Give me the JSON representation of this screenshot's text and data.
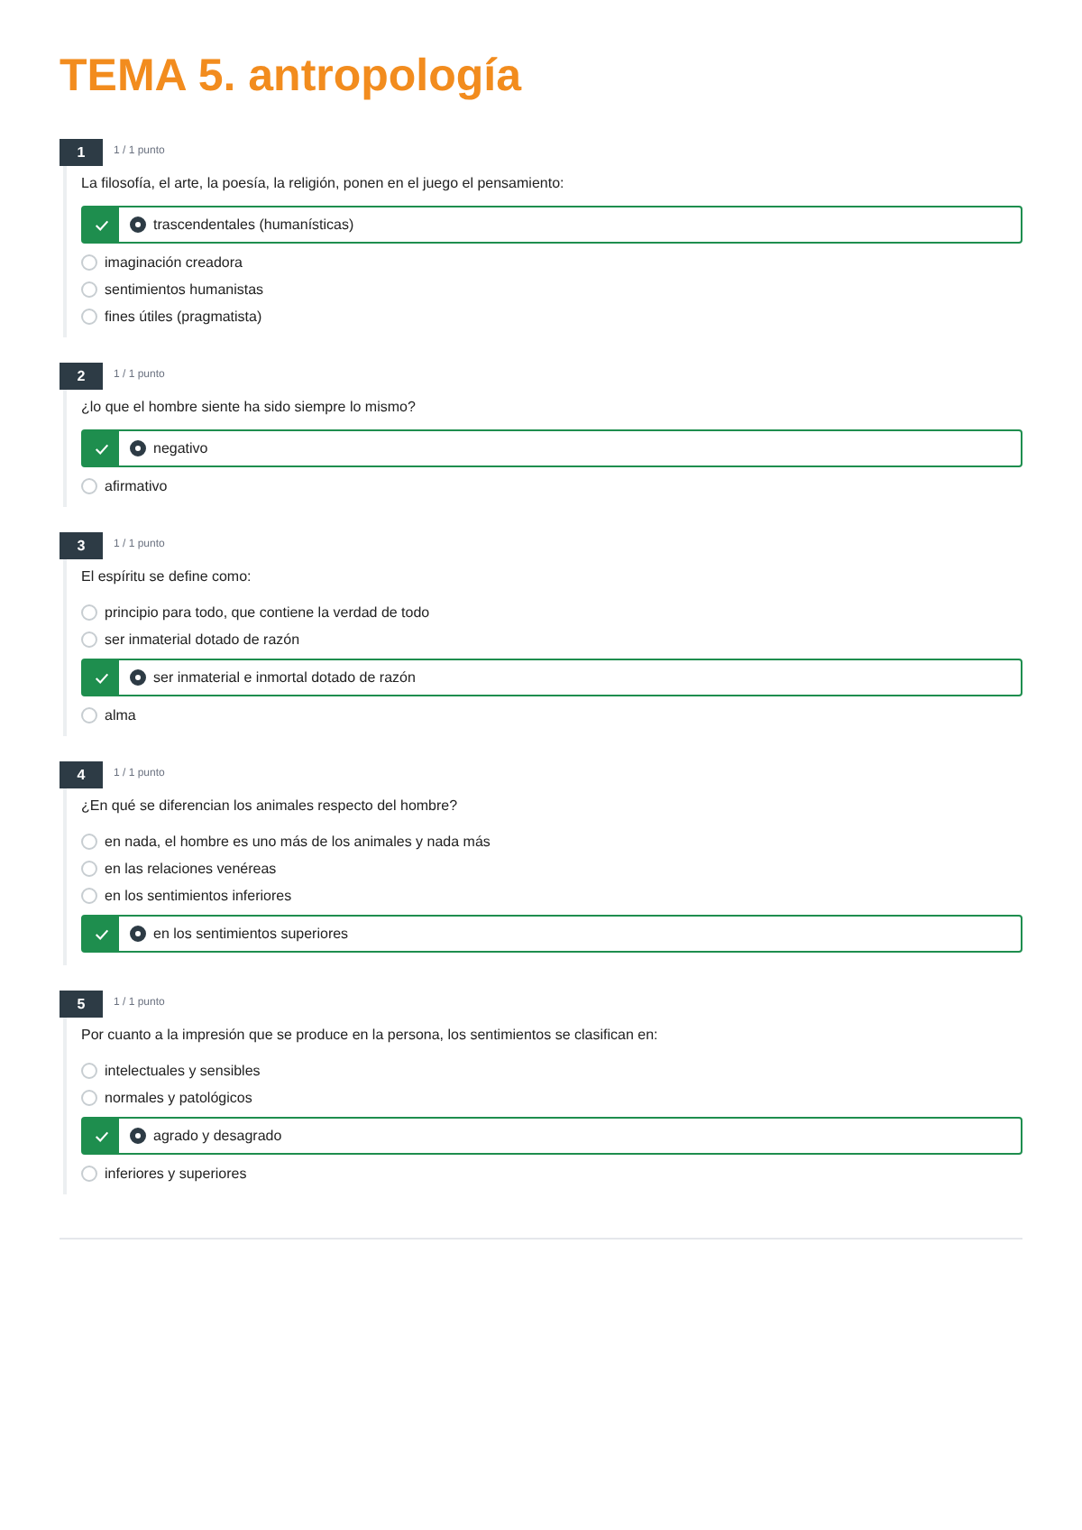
{
  "title": "TEMA 5. antropología",
  "questions": [
    {
      "number": "1",
      "points": "1 / 1 punto",
      "text": "La filosofía, el arte, la poesía, la religión, ponen en el juego el pensamiento:",
      "options": [
        {
          "label": "trascendentales (humanísticas)",
          "selected": true
        },
        {
          "label": "imaginación creadora",
          "selected": false
        },
        {
          "label": "sentimientos humanistas",
          "selected": false
        },
        {
          "label": "fines útiles (pragmatista)",
          "selected": false
        }
      ]
    },
    {
      "number": "2",
      "points": "1 / 1 punto",
      "text": "¿lo que el hombre siente ha sido siempre lo mismo?",
      "options": [
        {
          "label": "negativo",
          "selected": true
        },
        {
          "label": "afirmativo",
          "selected": false
        }
      ]
    },
    {
      "number": "3",
      "points": "1 / 1 punto",
      "text": "El espíritu se define como:",
      "options": [
        {
          "label": "principio para todo, que contiene la verdad de todo",
          "selected": false
        },
        {
          "label": "ser inmaterial dotado de razón",
          "selected": false
        },
        {
          "label": "ser inmaterial e inmortal dotado de razón",
          "selected": true
        },
        {
          "label": "alma",
          "selected": false
        }
      ]
    },
    {
      "number": "4",
      "points": "1 / 1 punto",
      "text": "¿En qué se diferencian los animales respecto del hombre?",
      "options": [
        {
          "label": "en nada, el hombre es uno más de los animales y nada más",
          "selected": false
        },
        {
          "label": "en las relaciones venéreas",
          "selected": false
        },
        {
          "label": "en los sentimientos inferiores",
          "selected": false
        },
        {
          "label": "en los sentimientos superiores",
          "selected": true
        }
      ]
    },
    {
      "number": "5",
      "points": "1 / 1 punto",
      "text": "Por cuanto a la impresión que se produce en la persona, los sentimientos se clasifican en:",
      "options": [
        {
          "label": "intelectuales y sensibles",
          "selected": false
        },
        {
          "label": "normales y patológicos",
          "selected": false
        },
        {
          "label": "agrado y desagrado",
          "selected": true
        },
        {
          "label": "inferiores y superiores",
          "selected": false
        }
      ]
    }
  ]
}
